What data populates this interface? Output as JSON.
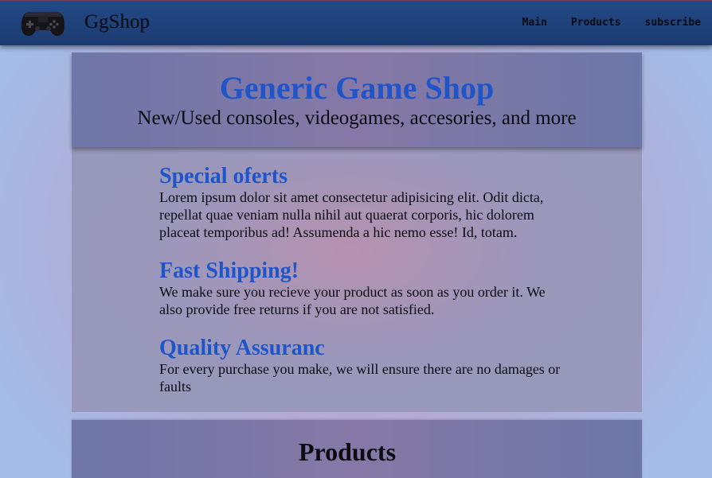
{
  "navbar": {
    "logo_icon": "gamepad-icon",
    "brand": "GgShop",
    "links": [
      "Main",
      "Products",
      "subscribe"
    ]
  },
  "hero": {
    "title": "Generic Game Shop",
    "subtitle": "New/Used consoles, videogames, accesories, and more"
  },
  "features": [
    {
      "title": "Special oferts",
      "text": "Lorem ipsum dolor sit amet consectetur adipisicing elit. Odit dicta, repellat quae veniam nulla nihil aut quaerat corporis, hic dolorem placeat temporibus ad! Assumenda a hic nemo esse! Id, totam."
    },
    {
      "title": "Fast Shipping!",
      "text": "We make sure you recieve your product as soon as you order it. We also provide free returns if you are not satisfied."
    },
    {
      "title": "Quality Assuranc",
      "text": "For every purchase you make, we will ensure there are no damages or faults"
    }
  ],
  "products": {
    "heading": "Products"
  },
  "colors": {
    "navbar": "#1b3a70",
    "accent_title": "#1f55c9",
    "text": "#0b0b12"
  }
}
